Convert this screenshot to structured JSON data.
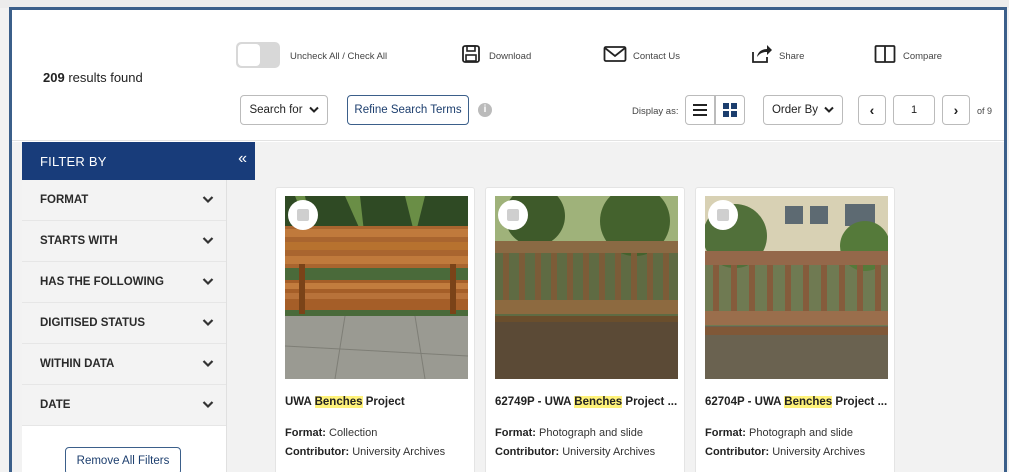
{
  "header": {
    "results_count": "209",
    "results_suffix": " results found",
    "toggle_label": "Uncheck All / Check All",
    "download_label": "Download",
    "contact_label": "Contact Us",
    "share_label": "Share",
    "compare_label": "Compare"
  },
  "controls": {
    "search_for": "Search for",
    "refine": "Refine Search Terms",
    "info_glyph": "i",
    "display_as": "Display as:",
    "order_by": "Order By",
    "page_prev": "‹",
    "page_next": "›",
    "current_page": "1",
    "of_pages": "of 9"
  },
  "filter": {
    "title": "FILTER BY",
    "collapse_glyph": "«",
    "items": [
      {
        "label": "FORMAT"
      },
      {
        "label": "STARTS WITH"
      },
      {
        "label": "HAS THE FOLLOWING"
      },
      {
        "label": "DIGITISED STATUS"
      },
      {
        "label": "WITHIN DATA"
      },
      {
        "label": "DATE"
      }
    ],
    "remove_all": "Remove All Filters"
  },
  "cards": [
    {
      "title_prefix": "UWA ",
      "title_highlight": "Benches",
      "title_suffix": " Project",
      "format_label": "Format:",
      "format_value": " Collection",
      "contributor_label": "Contributor:",
      "contributor_value": " University Archives"
    },
    {
      "title_prefix": "62749P - UWA ",
      "title_highlight": "Benches",
      "title_suffix": " Project ...",
      "format_label": "Format:",
      "format_value": " Photograph and slide",
      "contributor_label": "Contributor:",
      "contributor_value": " University Archives"
    },
    {
      "title_prefix": "62704P - UWA ",
      "title_highlight": "Benches",
      "title_suffix": " Project ...",
      "format_label": "Format:",
      "format_value": " Photograph and slide",
      "contributor_label": "Contributor:",
      "contributor_value": " University Archives"
    }
  ],
  "colors": {
    "brand_navy": "#183c7a",
    "frame_blue": "#3b5f8a",
    "highlight": "#fff27a",
    "grid_icon": "#1c3e6e"
  },
  "icons": [
    "download-icon",
    "mail-icon",
    "share-icon",
    "compare-icon",
    "chevron-down-icon",
    "list-view-icon",
    "grid-view-icon",
    "info-icon"
  ]
}
